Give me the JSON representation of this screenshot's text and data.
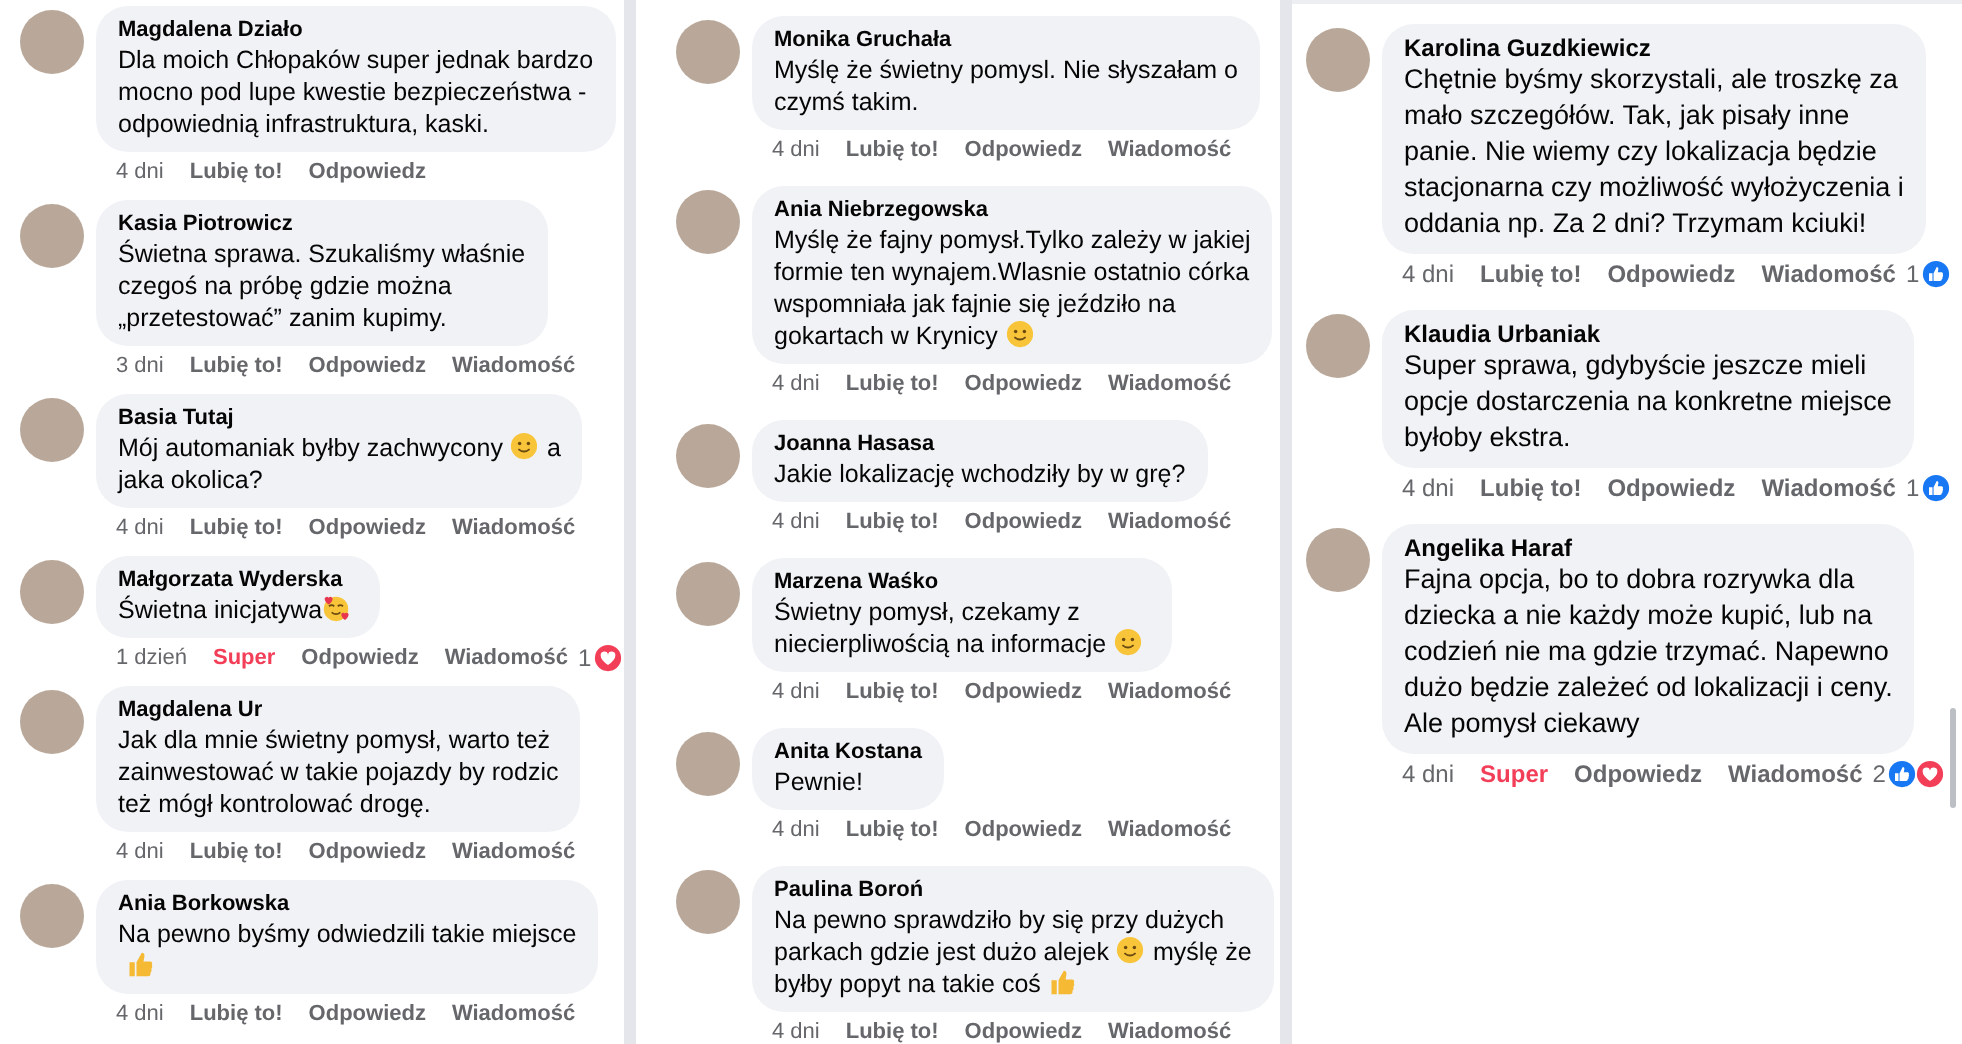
{
  "columns": [
    {
      "comments": [
        {
          "author": "Magdalena Działo",
          "lines": [
            [
              {
                "kind": "text",
                "text": "Dla moich Chłopaków super jednak bardzo"
              }
            ],
            [
              {
                "kind": "text",
                "text": "mocno pod lupe kwestie bezpieczeństwa -"
              }
            ],
            [
              {
                "kind": "text",
                "text": "odpowiednią infrastruktura, kaski."
              }
            ]
          ],
          "time": "4 dni",
          "like_label": "Lubię to!",
          "reacted": false,
          "reply": "Odpowiedz"
        },
        {
          "author": "Kasia Piotrowicz",
          "lines": [
            [
              {
                "kind": "text",
                "text": "Świetna sprawa. Szukaliśmy właśnie"
              }
            ],
            [
              {
                "kind": "text",
                "text": "czegoś na próbę gdzie można"
              }
            ],
            [
              {
                "kind": "text",
                "text": "„przetestować” zanim kupimy."
              }
            ]
          ],
          "time": "3 dni",
          "like_label": "Lubię to!",
          "reacted": false,
          "reply": "Odpowiedz",
          "message": "Wiadomość"
        },
        {
          "author": "Basia Tutaj",
          "lines": [
            [
              {
                "kind": "text",
                "text": "Mój automaniak byłby zachwycony"
              },
              {
                "kind": "smile"
              },
              {
                "kind": "text",
                "text": "a"
              }
            ],
            [
              {
                "kind": "text",
                "text": "jaka okolica?"
              }
            ]
          ],
          "time": "4 dni",
          "like_label": "Lubię to!",
          "reacted": false,
          "reply": "Odpowiedz",
          "message": "Wiadomość"
        },
        {
          "author": "Małgorzata Wyderska",
          "lines": [
            [
              {
                "kind": "text",
                "text": "Świetna inicjatywa"
              },
              {
                "kind": "hearts-face"
              }
            ]
          ],
          "time": "1 dzień",
          "like_label": "Super",
          "reacted": true,
          "reply": "Odpowiedz",
          "message": "Wiadomość",
          "reaction_count": "1",
          "reactions": [
            {
              "kind": "heart"
            }
          ]
        },
        {
          "author": "Magdalena Ur",
          "lines": [
            [
              {
                "kind": "text",
                "text": "Jak dla mnie świetny pomysł, warto też"
              }
            ],
            [
              {
                "kind": "text",
                "text": "zainwestować w takie pojazdy by rodzic"
              }
            ],
            [
              {
                "kind": "text",
                "text": "też mógł kontrolować drogę."
              }
            ]
          ],
          "time": "4 dni",
          "like_label": "Lubię to!",
          "reacted": false,
          "reply": "Odpowiedz",
          "message": "Wiadomość"
        },
        {
          "author": "Ania Borkowska",
          "lines": [
            [
              {
                "kind": "text",
                "text": "Na pewno byśmy odwiedzili takie miejsce"
              }
            ],
            [
              {
                "kind": "thumbs-up"
              }
            ]
          ],
          "time": "4 dni",
          "like_label": "Lubię to!",
          "reacted": false,
          "reply": "Odpowiedz",
          "message": "Wiadomość"
        }
      ]
    },
    {
      "comments": [
        {
          "author": "Monika Gruchała",
          "lines": [
            [
              {
                "kind": "text",
                "text": "Myślę że świetny pomysl. Nie słyszałam o"
              }
            ],
            [
              {
                "kind": "text",
                "text": "czymś takim."
              }
            ]
          ],
          "time": "4 dni",
          "like_label": "Lubię to!",
          "reacted": false,
          "reply": "Odpowiedz",
          "message": "Wiadomość"
        },
        {
          "author": "Ania Niebrzegowska",
          "lines": [
            [
              {
                "kind": "text",
                "text": "Myślę że fajny pomysł.Tylko zależy w jakiej"
              }
            ],
            [
              {
                "kind": "text",
                "text": "formie ten wynajem.Wlasnie ostatnio córka"
              }
            ],
            [
              {
                "kind": "text",
                "text": "wspomniała jak fajnie się jeździło na"
              }
            ],
            [
              {
                "kind": "text",
                "text": "gokartach w Krynicy"
              },
              {
                "kind": "smile"
              }
            ]
          ],
          "time": "4 dni",
          "like_label": "Lubię to!",
          "reacted": false,
          "reply": "Odpowiedz",
          "message": "Wiadomość"
        },
        {
          "author": "Joanna Hasasa",
          "lines": [
            [
              {
                "kind": "text",
                "text": "Jakie lokalizację wchodziły by w grę?"
              }
            ]
          ],
          "time": "4 dni",
          "like_label": "Lubię to!",
          "reacted": false,
          "reply": "Odpowiedz",
          "message": "Wiadomość"
        },
        {
          "author": "Marzena Waśko",
          "lines": [
            [
              {
                "kind": "text",
                "text": "Świetny pomysł, czekamy z"
              }
            ],
            [
              {
                "kind": "text",
                "text": "niecierpliwością na informacje"
              },
              {
                "kind": "smile"
              }
            ]
          ],
          "time": "4 dni",
          "like_label": "Lubię to!",
          "reacted": false,
          "reply": "Odpowiedz",
          "message": "Wiadomość"
        },
        {
          "author": "Anita Kostana",
          "lines": [
            [
              {
                "kind": "text",
                "text": "Pewnie!"
              }
            ]
          ],
          "time": "4 dni",
          "like_label": "Lubię to!",
          "reacted": false,
          "reply": "Odpowiedz",
          "message": "Wiadomość"
        },
        {
          "author": "Paulina Boroń",
          "lines": [
            [
              {
                "kind": "text",
                "text": "Na pewno sprawdziło by się przy dużych"
              }
            ],
            [
              {
                "kind": "text",
                "text": "parkach gdzie jest dużo alejek"
              },
              {
                "kind": "smile"
              },
              {
                "kind": "text",
                "text": "myślę że"
              }
            ],
            [
              {
                "kind": "text",
                "text": "byłby popyt na takie coś"
              },
              {
                "kind": "thumbs-up"
              }
            ]
          ],
          "time": "4 dni",
          "like_label": "Lubię to!",
          "reacted": false,
          "reply": "Odpowiedz",
          "message": "Wiadomość"
        }
      ]
    },
    {
      "comments": [
        {
          "author": "Karolina Guzdkiewicz",
          "lines": [
            [
              {
                "kind": "text",
                "text": "Chętnie byśmy skorzystali, ale troszkę za"
              }
            ],
            [
              {
                "kind": "text",
                "text": "mało szczegółów. Tak, jak pisały inne"
              }
            ],
            [
              {
                "kind": "text",
                "text": "panie. Nie wiemy czy lokalizacja będzie"
              }
            ],
            [
              {
                "kind": "text",
                "text": "stacjonarna czy możliwość wyłożyczenia i"
              }
            ],
            [
              {
                "kind": "text",
                "text": "oddania np. Za 2 dni? Trzymam kciuki!"
              }
            ]
          ],
          "time": "4 dni",
          "like_label": "Lubię to!",
          "reacted": false,
          "reply": "Odpowiedz",
          "message": "Wiadomość",
          "reaction_count": "1",
          "reactions": [
            {
              "kind": "like"
            }
          ]
        },
        {
          "author": "Klaudia Urbaniak",
          "lines": [
            [
              {
                "kind": "text",
                "text": "Super sprawa, gdybyście jeszcze mieli"
              }
            ],
            [
              {
                "kind": "text",
                "text": "opcje dostarczenia na konkretne miejsce"
              }
            ],
            [
              {
                "kind": "text",
                "text": "byłoby ekstra."
              }
            ]
          ],
          "time": "4 dni",
          "like_label": "Lubię to!",
          "reacted": false,
          "reply": "Odpowiedz",
          "message": "Wiadomość",
          "reaction_count": "1",
          "reactions": [
            {
              "kind": "like"
            }
          ]
        },
        {
          "author": "Angelika Haraf",
          "lines": [
            [
              {
                "kind": "text",
                "text": "Fajna opcja, bo to dobra rozrywka dla"
              }
            ],
            [
              {
                "kind": "text",
                "text": "dziecka a nie każdy może kupić, lub na"
              }
            ],
            [
              {
                "kind": "text",
                "text": "codzień nie ma gdzie trzymać. Napewno"
              }
            ],
            [
              {
                "kind": "text",
                "text": "dużo będzie zależeć od lokalizacji i ceny."
              }
            ],
            [
              {
                "kind": "text",
                "text": "Ale pomysł ciekawy"
              }
            ]
          ],
          "time": "4 dni",
          "like_label": "Super",
          "reacted": true,
          "reply": "Odpowiedz",
          "message": "Wiadomość",
          "reaction_count": "2",
          "reactions": [
            {
              "kind": "like"
            },
            {
              "kind": "heart"
            }
          ]
        }
      ]
    }
  ]
}
